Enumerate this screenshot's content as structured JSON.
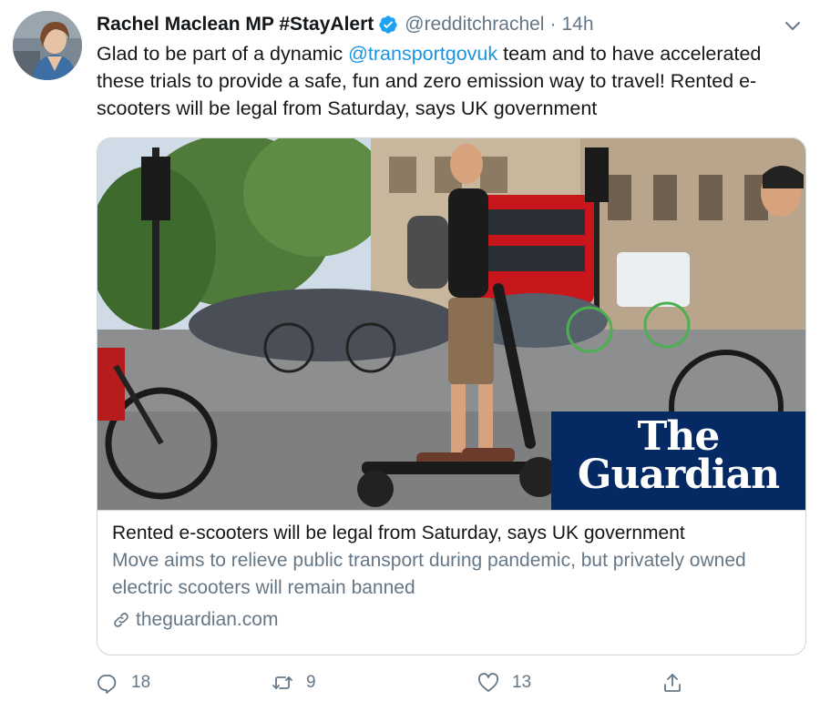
{
  "tweet": {
    "author": {
      "display_name": "Rachel Maclean MP #StayAlert",
      "handle": "@redditchrachel",
      "separator": "·",
      "time": "14h",
      "verified": true,
      "avatar_icon": "user-avatar"
    },
    "text": {
      "part1": "Glad to be part of a dynamic ",
      "mention": "@transportgovuk",
      "part2": " team and to have accelerated these trials to provide a safe, fun and zero emission way to travel! Rented e-scooters will be legal from Saturday, says UK government"
    },
    "card": {
      "brand_line1": "The",
      "brand_line2": "Guardian",
      "title": "Rented e-scooters will be legal from Saturday, says UK government",
      "description": "Move aims to relieve public transport during pandemic, but privately owned electric scooters will remain banned",
      "domain": "theguardian.com",
      "link_icon": "link-icon"
    },
    "actions": {
      "replies": "18",
      "retweets": "9",
      "likes": "13"
    }
  },
  "colors": {
    "accent": "#1b95e0",
    "muted": "#657786",
    "text": "#14171a",
    "verified": "#1da1f2",
    "guardian_blue": "#052962"
  }
}
